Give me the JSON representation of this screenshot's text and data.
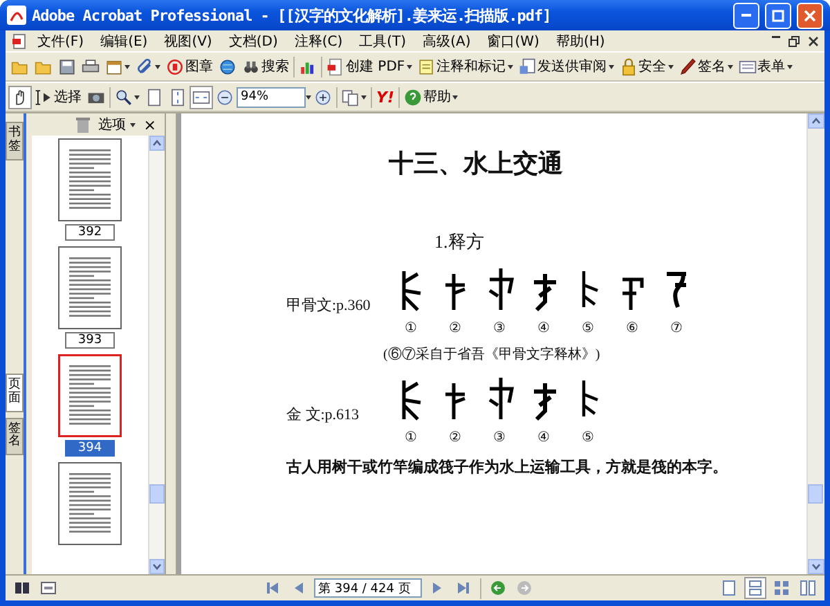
{
  "window": {
    "title": "Adobe Acrobat Professional - [[汉字的文化解析].姜来运.扫描版.pdf]"
  },
  "menu": [
    "文件(F)",
    "编辑(E)",
    "视图(V)",
    "文档(D)",
    "注释(C)",
    "工具(T)",
    "高级(A)",
    "窗口(W)",
    "帮助(H)"
  ],
  "toolbar_1": {
    "stamp": "图章",
    "search": "搜索",
    "create_pdf": "创建 PDF",
    "comment": "注释和标记",
    "review": "发送供审阅",
    "security": "安全",
    "sign": "签名",
    "forms": "表单"
  },
  "toolbar_2": {
    "hand_tool_selected": true,
    "select": "选择",
    "fit_width_selected": true,
    "zoom": "94%",
    "yahoo": "Y!",
    "help": "帮助"
  },
  "nav_tabs": [
    {
      "label": "书签",
      "selected": false
    },
    {
      "label": "页面",
      "selected": true
    },
    {
      "label": "签名",
      "selected": false
    }
  ],
  "panel": {
    "options": "选项",
    "close": "×"
  },
  "thumbnails": [
    {
      "label": "392",
      "selected": false
    },
    {
      "label": "393",
      "selected": false
    },
    {
      "label": "394",
      "selected": true
    },
    {
      "selected": false
    }
  ],
  "document": [
    {
      "kind": "heading",
      "text": "十三、水上交通"
    },
    {
      "kind": "subheading",
      "text": "1.释方"
    },
    {
      "kind": "glyph_row",
      "label": "甲骨文:p.360",
      "numbers": [
        "①",
        "②",
        "③",
        "④",
        "⑤",
        "⑥",
        "⑦"
      ]
    },
    {
      "kind": "caption",
      "text": "(⑥⑦采自于省吾《甲骨文字释林》)"
    },
    {
      "kind": "glyph_row",
      "label": "金 文:p.613",
      "numbers": [
        "①",
        "②",
        "③",
        "④",
        "⑤"
      ]
    },
    {
      "kind": "paragraph",
      "text": "古人用树干或竹竿编成筏子作为水上运输工具，方就是筏的本字。"
    }
  ],
  "status_bar": {
    "page_field": "第 394 / 424 页",
    "page_layouts": [
      {
        "selected": false
      },
      {
        "selected": true
      },
      {
        "selected": false
      },
      {
        "selected": false
      }
    ]
  }
}
